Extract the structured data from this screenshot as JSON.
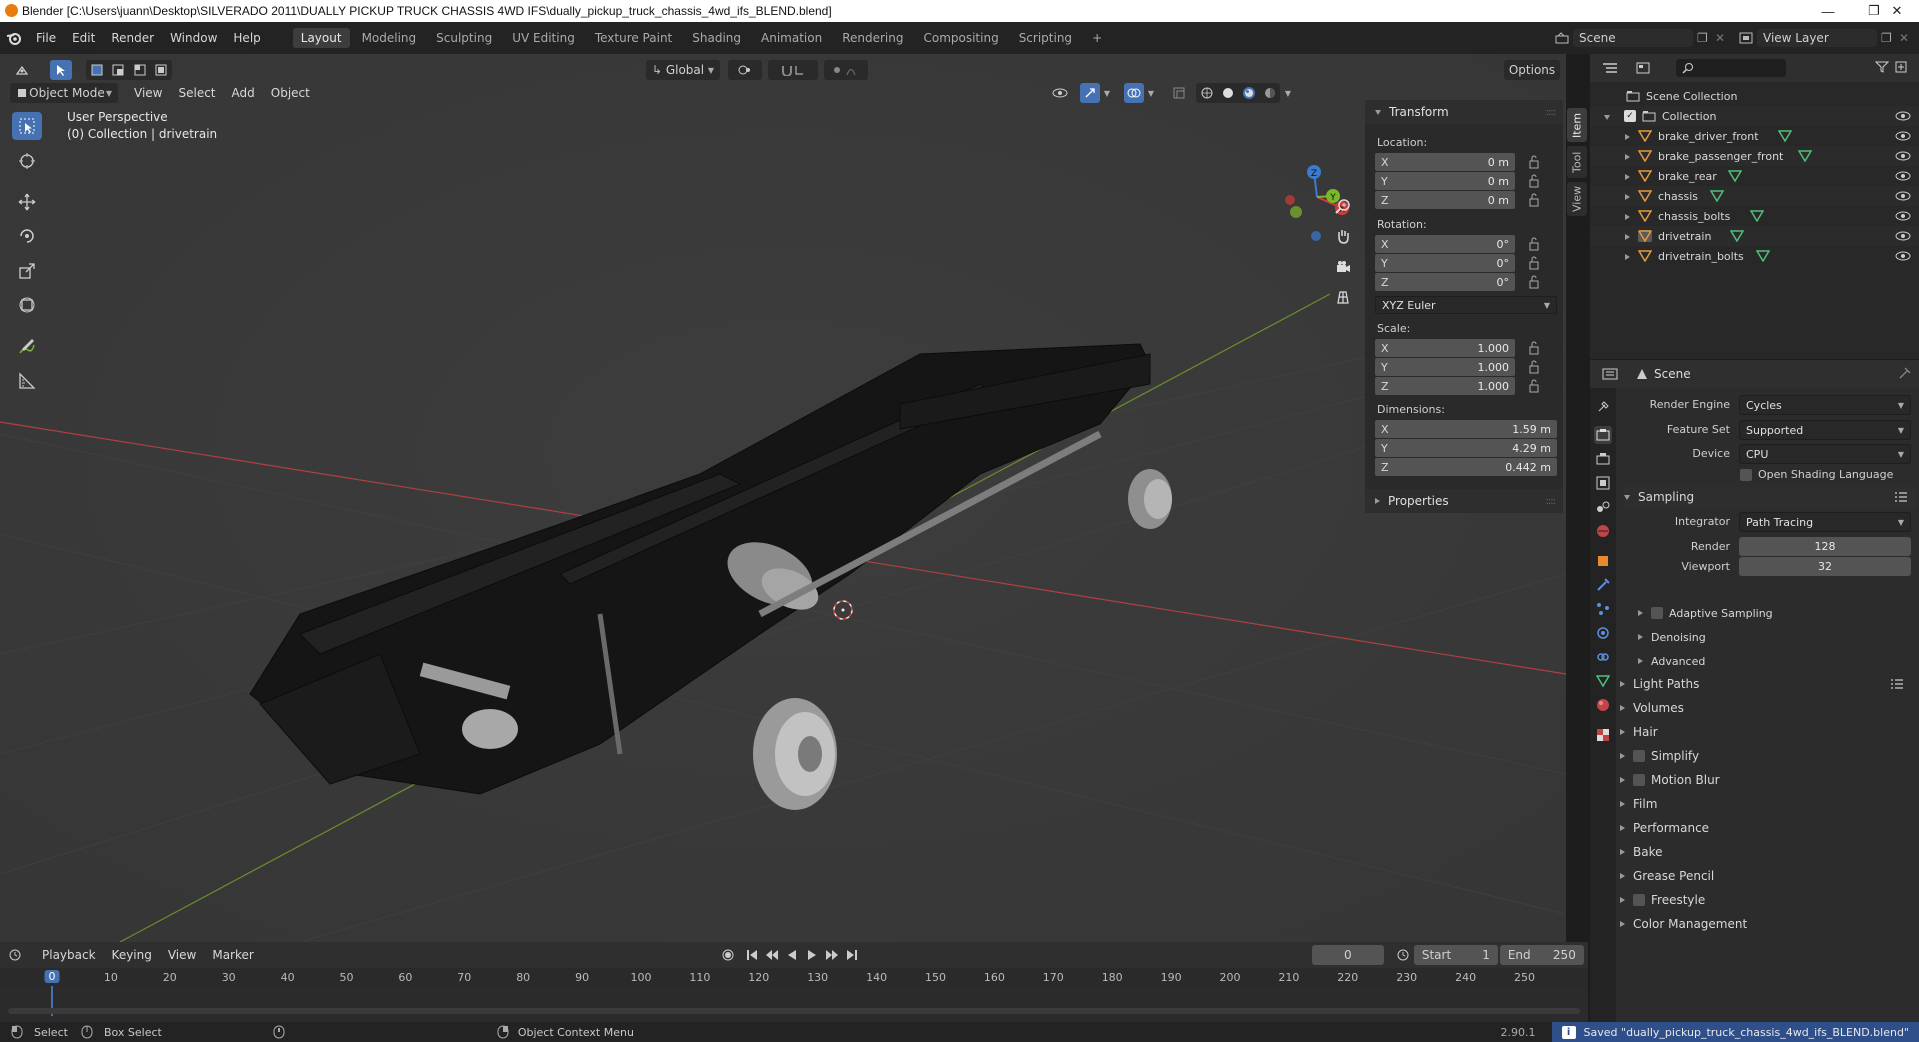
{
  "window": {
    "title": "Blender [C:\\Users\\juann\\Desktop\\SILVERADO 2011\\DUALLY PICKUP TRUCK CHASSIS 4WD IFS\\dually_pickup_truck_chassis_4wd_ifs_BLEND.blend]",
    "minimize": "—",
    "maximize": "❐",
    "close": "✕"
  },
  "menubar": {
    "items": [
      "File",
      "Edit",
      "Render",
      "Window",
      "Help"
    ],
    "workspaces": [
      "Layout",
      "Modeling",
      "Sculpting",
      "UV Editing",
      "Texture Paint",
      "Shading",
      "Animation",
      "Rendering",
      "Compositing",
      "Scripting"
    ],
    "active_workspace": "Layout",
    "add_tab": "+",
    "scene": "Scene",
    "view_layer": "View Layer"
  },
  "viewport": {
    "orientation": "Global",
    "options": "Options",
    "mode": "Object Mode",
    "menus": [
      "View",
      "Select",
      "Add",
      "Object"
    ],
    "perspective_label": "User Perspective",
    "collection_label": "(0) Collection | drivetrain",
    "gizmo_axes": {
      "x": "X",
      "y": "Y",
      "z": "Z"
    }
  },
  "npanel": {
    "tabs": [
      "Item",
      "Tool",
      "View"
    ],
    "transform_title": "Transform",
    "location_label": "Location:",
    "location": [
      {
        "axis": "X",
        "value": "0 m"
      },
      {
        "axis": "Y",
        "value": "0 m"
      },
      {
        "axis": "Z",
        "value": "0 m"
      }
    ],
    "rotation_label": "Rotation:",
    "rotation": [
      {
        "axis": "X",
        "value": "0°"
      },
      {
        "axis": "Y",
        "value": "0°"
      },
      {
        "axis": "Z",
        "value": "0°"
      }
    ],
    "rotation_mode": "XYZ Euler",
    "scale_label": "Scale:",
    "scale": [
      {
        "axis": "X",
        "value": "1.000"
      },
      {
        "axis": "Y",
        "value": "1.000"
      },
      {
        "axis": "Z",
        "value": "1.000"
      }
    ],
    "dimensions_label": "Dimensions:",
    "dimensions": [
      {
        "axis": "X",
        "value": "1.59 m"
      },
      {
        "axis": "Y",
        "value": "4.29 m"
      },
      {
        "axis": "Z",
        "value": "0.442 m"
      }
    ],
    "properties_title": "Properties"
  },
  "outliner": {
    "scene_collection": "Scene Collection",
    "collection": "Collection",
    "objects": [
      "brake_driver_front",
      "brake_passenger_front",
      "brake_rear",
      "chassis",
      "chassis_bolts",
      "drivetrain",
      "drivetrain_bolts"
    ]
  },
  "properties": {
    "context": "Scene",
    "render_engine_label": "Render Engine",
    "render_engine": "Cycles",
    "feature_set_label": "Feature Set",
    "feature_set": "Supported",
    "device_label": "Device",
    "device": "CPU",
    "osl_label": "Open Shading Language",
    "sampling": "Sampling",
    "integrator_label": "Integrator",
    "integrator": "Path Tracing",
    "render_label": "Render",
    "render_samples": "128",
    "viewport_label": "Viewport",
    "viewport_samples": "32",
    "sub_sections": [
      "Adaptive Sampling",
      "Denoising",
      "Advanced"
    ],
    "sections": [
      "Light Paths",
      "Volumes",
      "Hair",
      "Simplify",
      "Motion Blur",
      "Film",
      "Performance",
      "Bake",
      "Grease Pencil",
      "Freestyle",
      "Color Management"
    ]
  },
  "timeline": {
    "menus": [
      "Playback",
      "Keying",
      "View",
      "Marker"
    ],
    "current_frame": "0",
    "start_label": "Start",
    "start": "1",
    "end_label": "End",
    "end": "250",
    "ticks": [
      "0",
      "10",
      "20",
      "30",
      "40",
      "50",
      "60",
      "70",
      "80",
      "90",
      "100",
      "110",
      "120",
      "130",
      "140",
      "150",
      "160",
      "170",
      "180",
      "190",
      "200",
      "210",
      "220",
      "230",
      "240",
      "250"
    ]
  },
  "statusbar": {
    "select": "Select",
    "box_select": "Box Select",
    "context_menu": "Object Context Menu",
    "version": "2.90.1",
    "message": "Saved \"dually_pickup_truck_chassis_4wd_ifs_BLEND.blend\""
  },
  "colors": {
    "accent_blue": "#4672b3",
    "blender_orange": "#e87d0d",
    "x_axis": "#d03b3b",
    "y_axis": "#7ab82b",
    "z_axis": "#3b7bd0"
  }
}
